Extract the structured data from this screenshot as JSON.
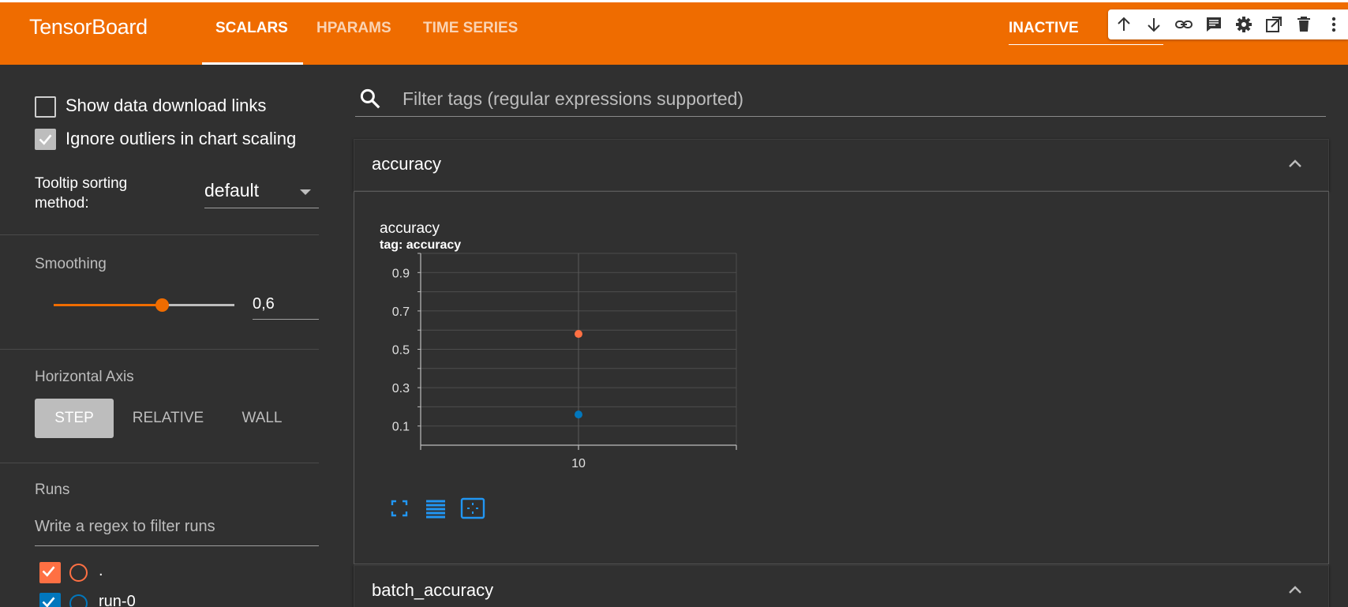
{
  "app": {
    "brand": "TensorBoard",
    "tabs": [
      {
        "label": "SCALARS",
        "active": true
      },
      {
        "label": "HPARAMS",
        "active": false
      },
      {
        "label": "TIME SERIES",
        "active": false
      }
    ],
    "status": "INACTIVE",
    "accent_color": "#ef6c00"
  },
  "floating_toolbar": {
    "icons": [
      "arrow-up-icon",
      "arrow-down-icon",
      "link-icon",
      "comment-icon",
      "gear-icon",
      "open-external-icon",
      "trash-icon",
      "more-vertical-icon"
    ]
  },
  "sidebar": {
    "show_download_links": {
      "label": "Show data download links",
      "checked": false
    },
    "ignore_outliers": {
      "label": "Ignore outliers in chart scaling",
      "checked": true
    },
    "tooltip_sorting": {
      "label": "Tooltip sorting method:",
      "value": "default"
    },
    "smoothing": {
      "label": "Smoothing",
      "value": "0,6",
      "level": 0.6
    },
    "horizontal_axis": {
      "label": "Horizontal Axis",
      "options": [
        {
          "label": "STEP",
          "active": true
        },
        {
          "label": "RELATIVE",
          "active": false
        },
        {
          "label": "WALL",
          "active": false
        }
      ]
    },
    "runs": {
      "label": "Runs",
      "filter_placeholder": "Write a regex to filter runs",
      "items": [
        {
          "name": ".",
          "color": "#ff7043",
          "checked": true
        },
        {
          "name": "run-0",
          "color": "#0277bd",
          "checked": true
        }
      ]
    }
  },
  "main": {
    "filter_placeholder": "Filter tags (regular expressions supported)",
    "sections": [
      {
        "title": "accuracy",
        "expanded": true
      },
      {
        "title": "batch_accuracy",
        "expanded": true
      }
    ],
    "chart_tools": [
      "fit-to-view-icon",
      "toggle-log-scale-icon",
      "expand-chart-icon"
    ]
  },
  "chart_data": {
    "type": "scatter",
    "title": "accuracy",
    "subtitle": "tag: accuracy",
    "xlabel": "",
    "ylabel": "",
    "x_ticks": [
      10
    ],
    "y_ticks": [
      0.1,
      0.3,
      0.5,
      0.7,
      0.9
    ],
    "xlim": [
      0,
      20
    ],
    "ylim": [
      0,
      1
    ],
    "grid": true,
    "series": [
      {
        "color": "#ff7043",
        "points": [
          {
            "x": 10,
            "y": 0.58
          }
        ]
      },
      {
        "color": "#0277bd",
        "points": [
          {
            "x": 10,
            "y": 0.16
          }
        ]
      }
    ]
  }
}
